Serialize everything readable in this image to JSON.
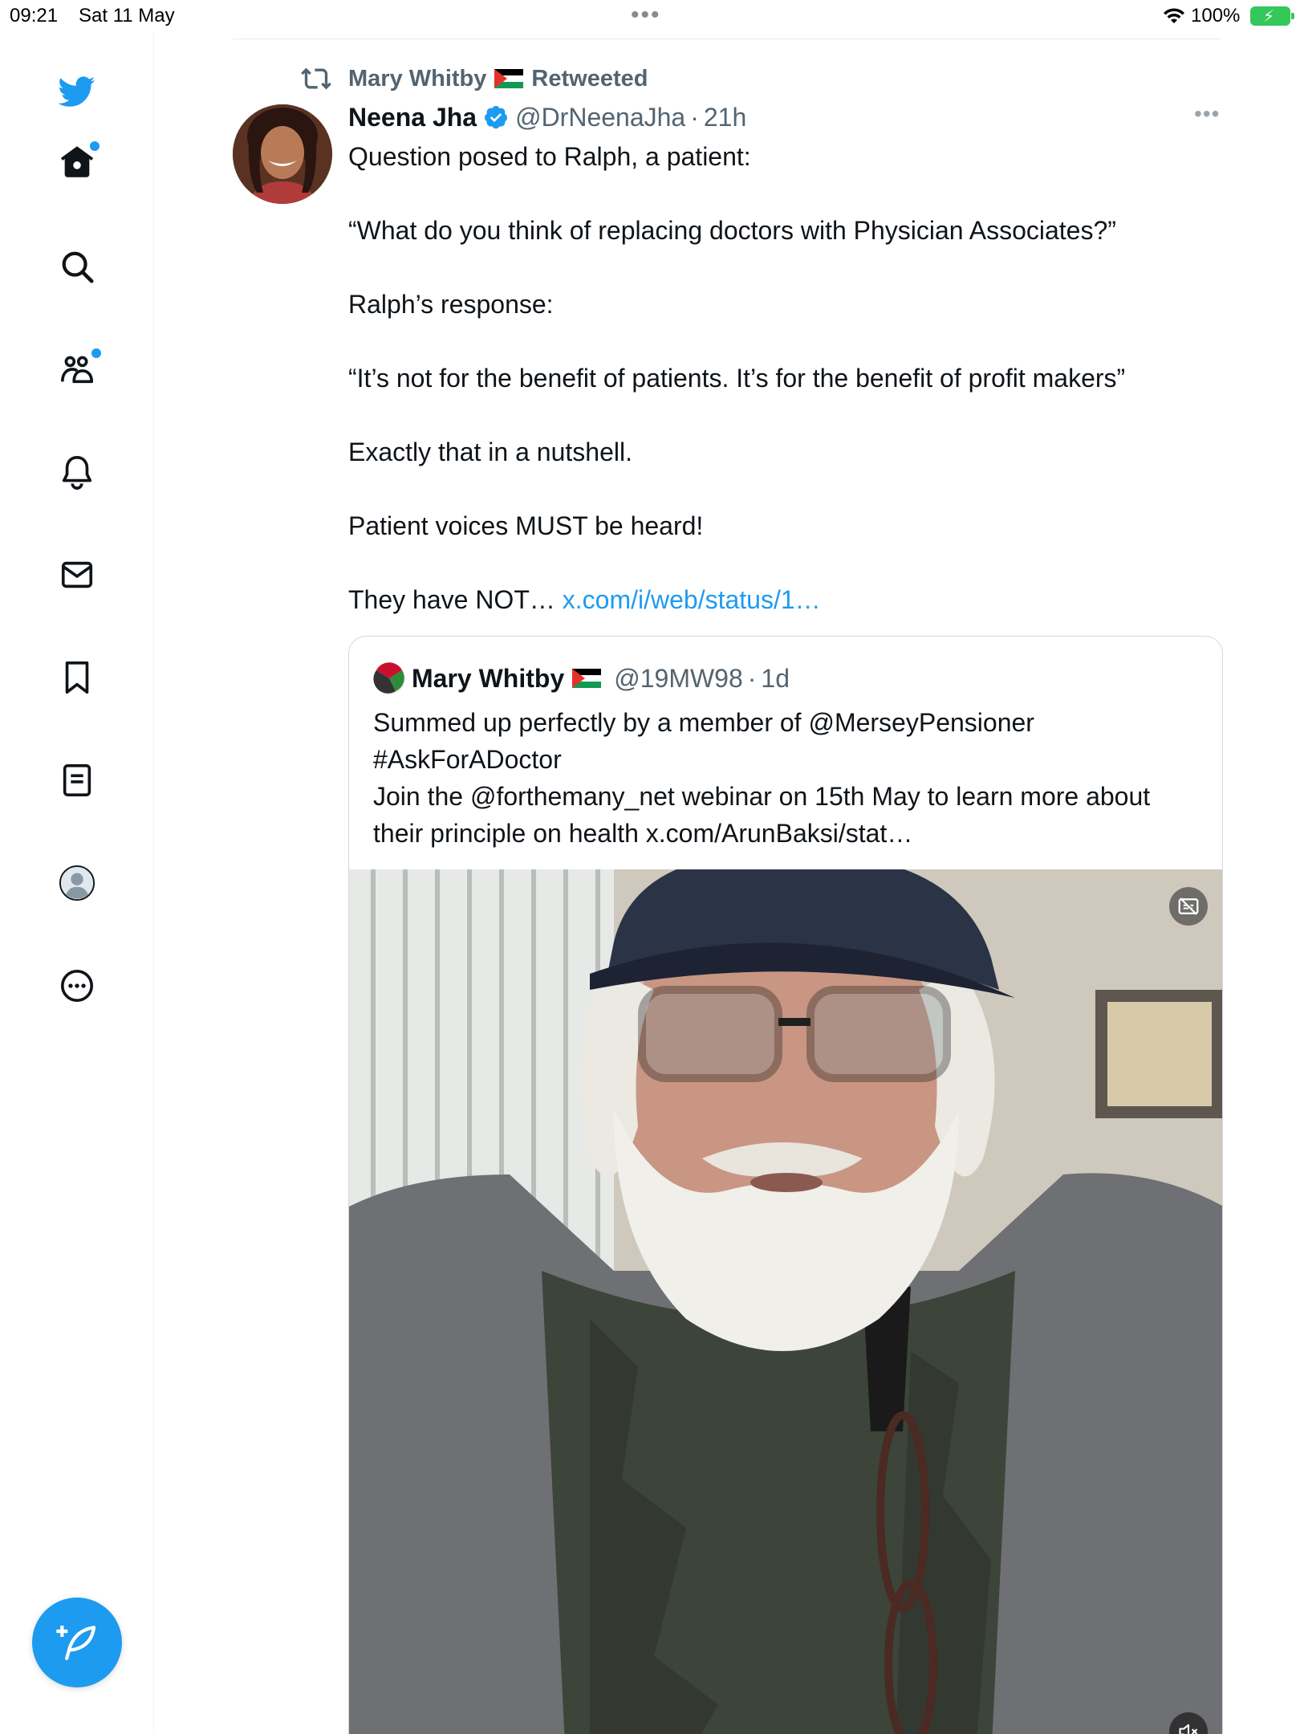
{
  "status_bar": {
    "time": "09:21",
    "date": "Sat 11 May",
    "multitask_dots": "•••",
    "battery_percent": "100%",
    "battery_level": 1.0,
    "battery_color": "#34c759"
  },
  "nav": {
    "brand_color": "#1d9bf0",
    "items": [
      {
        "name": "home",
        "icon": "home-icon",
        "has_badge": true
      },
      {
        "name": "search",
        "icon": "search-icon",
        "has_badge": false
      },
      {
        "name": "communities",
        "icon": "communities-icon",
        "has_badge": true
      },
      {
        "name": "notifications",
        "icon": "bell-icon",
        "has_badge": false
      },
      {
        "name": "messages",
        "icon": "envelope-icon",
        "has_badge": false
      },
      {
        "name": "bookmarks",
        "icon": "bookmark-icon",
        "has_badge": false
      },
      {
        "name": "lists",
        "icon": "list-icon",
        "has_badge": false
      },
      {
        "name": "profile",
        "icon": "profile-icon",
        "has_badge": false
      },
      {
        "name": "more",
        "icon": "more-circle-icon",
        "has_badge": false
      }
    ],
    "compose_icon": "compose-feather-icon"
  },
  "tweet": {
    "retweeted_by": "Mary Whitby",
    "retweeted_label": "Retweeted",
    "author_name": "Neena Jha",
    "author_handle": "@DrNeenaJha",
    "separator": "·",
    "time_ago": "21h",
    "more_label": "•••",
    "text_lines": [
      "Question posed to Ralph, a patient:",
      "",
      "“What do you think of replacing doctors with Physician Associates?”",
      "",
      "Ralph’s response:",
      "",
      "“It’s not for the benefit of patients. It’s for the benefit of profit makers”",
      "",
      "Exactly that in a nutshell.",
      "",
      "Patient voices MUST be heard!",
      ""
    ],
    "last_line_text": "They have NOT… ",
    "last_line_link": "x.com/i/web/status/1…",
    "link_color": "#1d9bf0"
  },
  "quote": {
    "author_name": "Mary Whitby",
    "author_handle": "@19MW98",
    "separator": "·",
    "time_ago": "1d",
    "text_lines": [
      "Summed up perfectly by a member of @MerseyPensioner",
      "#AskForADoctor",
      "Join the @forthemany_net webinar on 15th May to learn more about",
      "their principle on health x.com/ArunBaksi/stat…"
    ]
  }
}
